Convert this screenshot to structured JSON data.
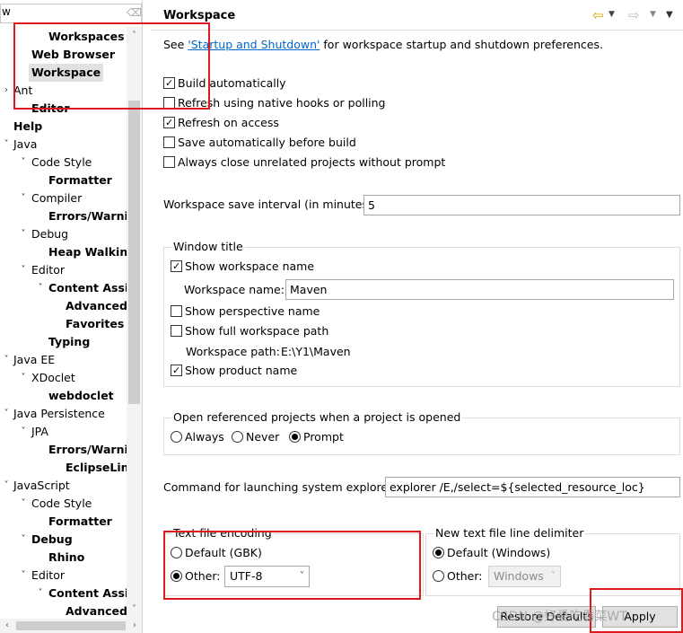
{
  "tree": {
    "filter_value": "w",
    "items": [
      {
        "label": "Workspaces",
        "level": 2,
        "bold": true,
        "arrow": ""
      },
      {
        "label": "Web Browser",
        "level": 1,
        "bold": true,
        "arrow": ""
      },
      {
        "label": "Workspace",
        "level": 1,
        "bold": true,
        "arrow": "",
        "selected": true
      },
      {
        "label": "Ant",
        "level": 0,
        "bold": false,
        "arrow": "›"
      },
      {
        "label": "Editor",
        "level": 1,
        "bold": true,
        "arrow": ""
      },
      {
        "label": "Help",
        "level": 0,
        "bold": true,
        "arrow": ""
      },
      {
        "label": "Java",
        "level": 0,
        "bold": false,
        "arrow": "˅"
      },
      {
        "label": "Code Style",
        "level": 1,
        "bold": false,
        "arrow": "˅"
      },
      {
        "label": "Formatter",
        "level": 2,
        "bold": true,
        "arrow": ""
      },
      {
        "label": "Compiler",
        "level": 1,
        "bold": false,
        "arrow": "˅"
      },
      {
        "label": "Errors/Warnin",
        "level": 2,
        "bold": true,
        "arrow": ""
      },
      {
        "label": "Debug",
        "level": 1,
        "bold": false,
        "arrow": "˅"
      },
      {
        "label": "Heap Walking",
        "level": 2,
        "bold": true,
        "arrow": ""
      },
      {
        "label": "Editor",
        "level": 1,
        "bold": false,
        "arrow": "˅"
      },
      {
        "label": "Content Assist",
        "level": 2,
        "bold": true,
        "arrow": "˅"
      },
      {
        "label": "Advanced",
        "level": 3,
        "bold": true,
        "arrow": ""
      },
      {
        "label": "Favorites",
        "level": 3,
        "bold": true,
        "arrow": ""
      },
      {
        "label": "Typing",
        "level": 2,
        "bold": true,
        "arrow": ""
      },
      {
        "label": "Java EE",
        "level": 0,
        "bold": false,
        "arrow": "˅"
      },
      {
        "label": "XDoclet",
        "level": 1,
        "bold": false,
        "arrow": "˅"
      },
      {
        "label": "webdoclet",
        "level": 2,
        "bold": true,
        "arrow": ""
      },
      {
        "label": "Java Persistence",
        "level": 0,
        "bold": false,
        "arrow": "˅"
      },
      {
        "label": "JPA",
        "level": 1,
        "bold": false,
        "arrow": "˅"
      },
      {
        "label": "Errors/Warnin",
        "level": 2,
        "bold": true,
        "arrow": ""
      },
      {
        "label": "EclipseLink",
        "level": 3,
        "bold": true,
        "arrow": ""
      },
      {
        "label": "JavaScript",
        "level": 0,
        "bold": false,
        "arrow": "˅"
      },
      {
        "label": "Code Style",
        "level": 1,
        "bold": false,
        "arrow": "˅"
      },
      {
        "label": "Formatter",
        "level": 2,
        "bold": true,
        "arrow": ""
      },
      {
        "label": "Debug",
        "level": 1,
        "bold": true,
        "arrow": "˅"
      },
      {
        "label": "Rhino",
        "level": 2,
        "bold": true,
        "arrow": ""
      },
      {
        "label": "Editor",
        "level": 1,
        "bold": false,
        "arrow": "˅"
      },
      {
        "label": "Content Assist",
        "level": 2,
        "bold": true,
        "arrow": "˅"
      },
      {
        "label": "Advanced",
        "level": 3,
        "bold": true,
        "arrow": ""
      }
    ]
  },
  "page": {
    "title": "Workspace",
    "see_prefix": "See ",
    "see_link": "'Startup and Shutdown'",
    "see_suffix": " for workspace startup and shutdown preferences.",
    "checkboxes": [
      {
        "label": "Build automatically",
        "checked": true
      },
      {
        "label": "Refresh using native hooks or polling",
        "checked": false
      },
      {
        "label": "Refresh on access",
        "checked": true
      },
      {
        "label": "Save automatically before build",
        "checked": false
      },
      {
        "label": "Always close unrelated projects without prompt",
        "checked": false
      }
    ],
    "save_interval_label": "Workspace save interval (in minutes):",
    "save_interval_value": "5",
    "window_title": {
      "group_label": "Window title",
      "show_workspace_name": "Show workspace name",
      "workspace_name_label": "Workspace name:",
      "workspace_name_value": "Maven",
      "show_perspective_name": "Show perspective name",
      "show_full_path": "Show full workspace path",
      "workspace_path_label": "Workspace path:",
      "workspace_path_value": "E:\\Y1\\Maven",
      "show_product_name": "Show product name"
    },
    "open_ref": {
      "group_label": "Open referenced projects when a project is opened",
      "options": [
        "Always",
        "Never",
        "Prompt"
      ],
      "selected": "Prompt"
    },
    "explorer_label": "Command for launching system explorer:",
    "explorer_value": "explorer /E,/select=${selected_resource_loc}",
    "encoding": {
      "group_label": "Text file encoding",
      "default_label": "Default (GBK)",
      "other_label": "Other:",
      "other_value": "UTF-8"
    },
    "line_delimiter": {
      "group_label": "New text file line delimiter",
      "default_label": "Default (Windows)",
      "other_label": "Other:",
      "other_value": "Windows"
    },
    "restore_button": "Restore Defaults",
    "apply_button": "Apply",
    "watermark": "CSDN @好爱吃香菜WT"
  },
  "colors": {
    "highlight_box": "#e0191f",
    "link": "#0066cc",
    "selection": "#e1e1e1"
  }
}
